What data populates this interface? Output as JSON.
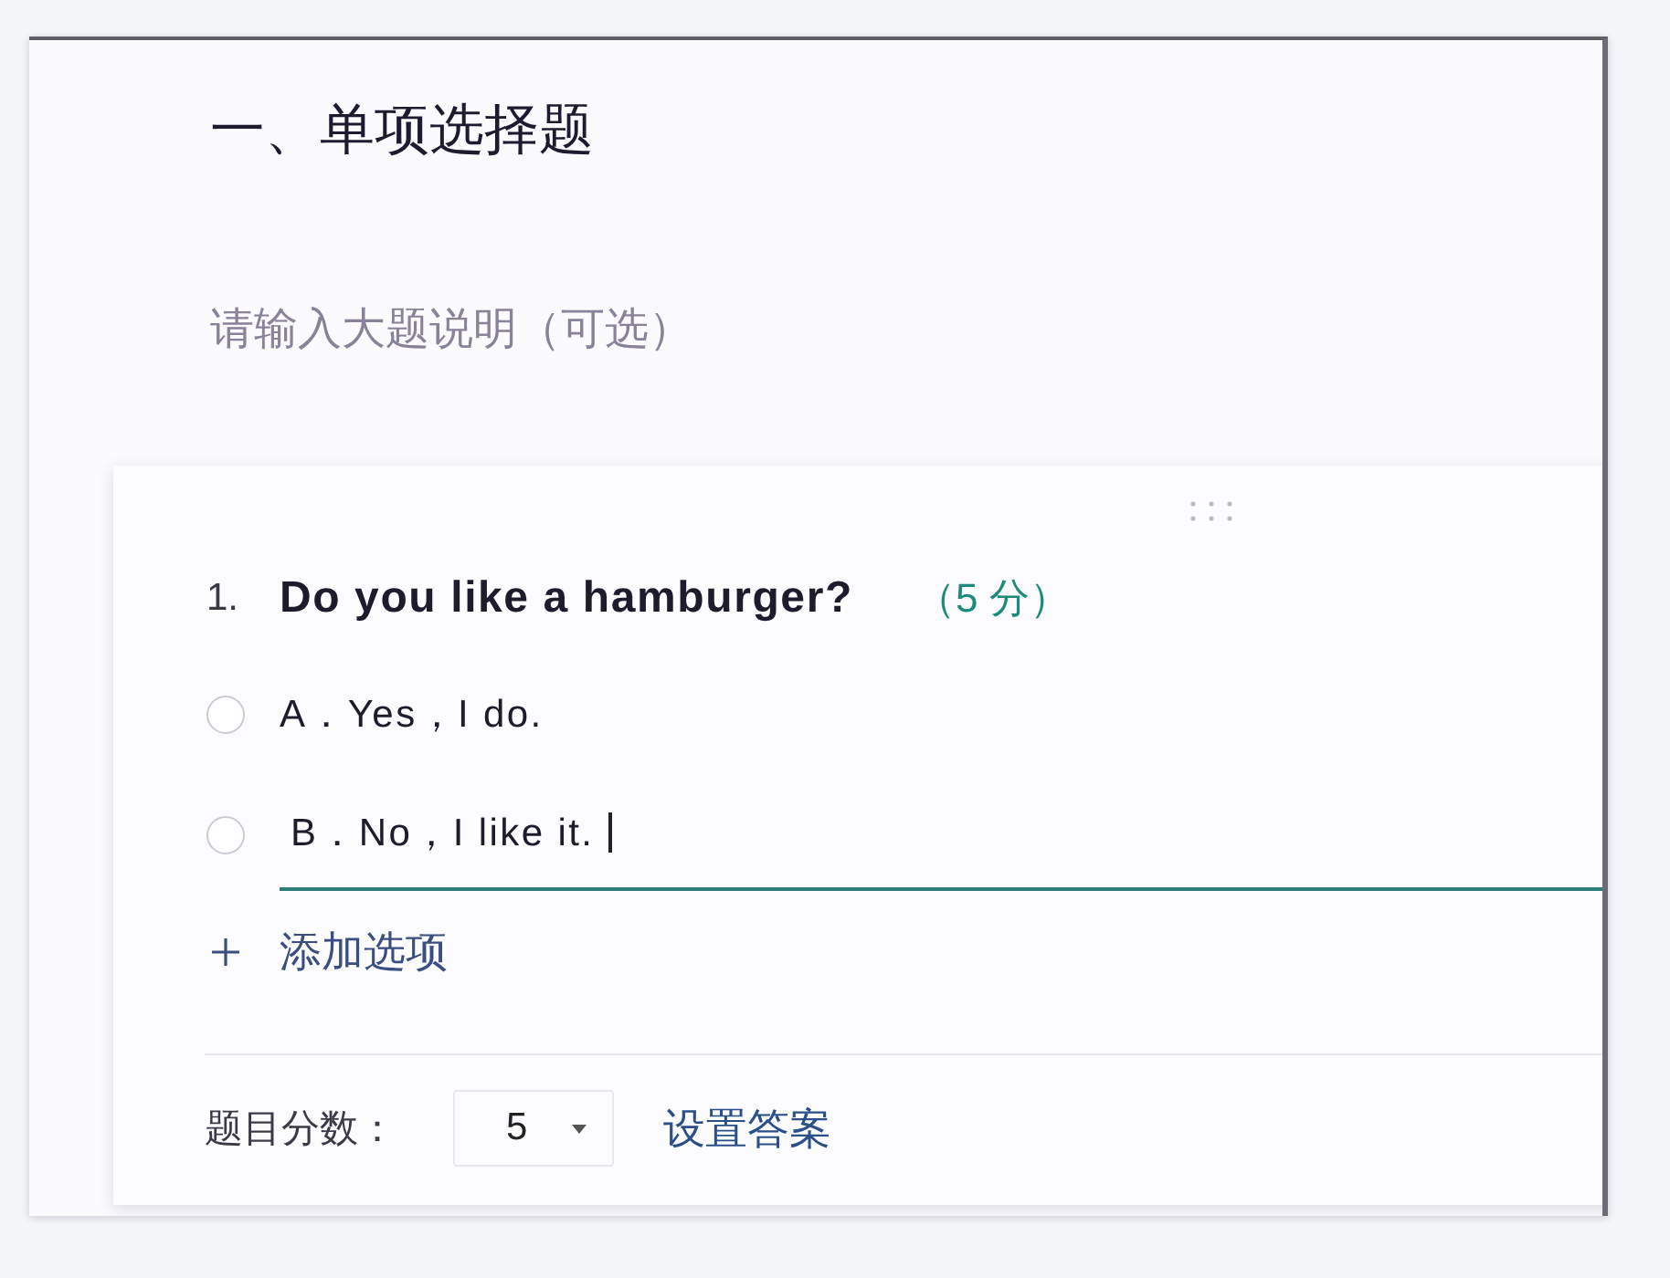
{
  "section": {
    "title": "一、单项选择题",
    "description": {
      "placeholder": "请输入大题说明（可选）"
    }
  },
  "question": {
    "number": "1.",
    "text": "Do you like a hamburger?",
    "score": "（5 分）",
    "options": [
      {
        "label": "A．Yes，I do.",
        "selected": false,
        "editing": false
      },
      {
        "label": "B．No，I like it.",
        "selected": false,
        "editing": true
      }
    ],
    "add_option": "添加选项",
    "footer": {
      "score_label": "题目分数：",
      "score_select": {
        "value": "5"
      },
      "set_answer": "设置答案"
    }
  }
}
